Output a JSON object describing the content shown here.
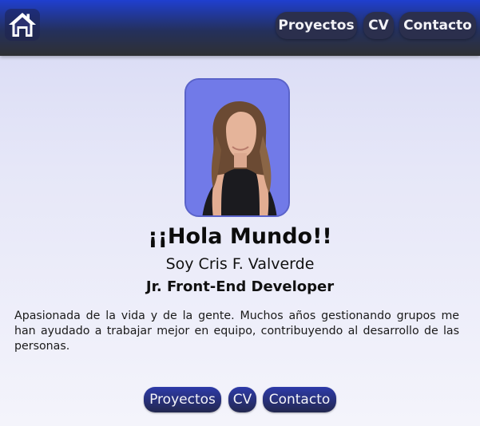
{
  "header": {
    "home_icon": "home-icon",
    "nav": {
      "projects_label": "Proyectos",
      "cv_label": "CV",
      "contact_label": "Contacto"
    }
  },
  "profile": {
    "greeting": "¡¡Hola Mundo!!",
    "name": "Soy Cris F. Valverde",
    "role": "Jr. Front-End Developer",
    "bio": "Apasionada de la vida y de la gente. Muchos años gestionando grupos me han ayudado a trabajar mejor en equipo, contribuyendo al desarrollo de las personas."
  },
  "footer_nav": {
    "projects_label": "Proyectos",
    "cv_label": "CV",
    "contact_label": "Contacto"
  },
  "colors": {
    "header_top": "#1f3fcf",
    "header_bottom": "#2f3033",
    "button_bg": "#2b2f4d",
    "photo_bg": "#6f78e6"
  }
}
